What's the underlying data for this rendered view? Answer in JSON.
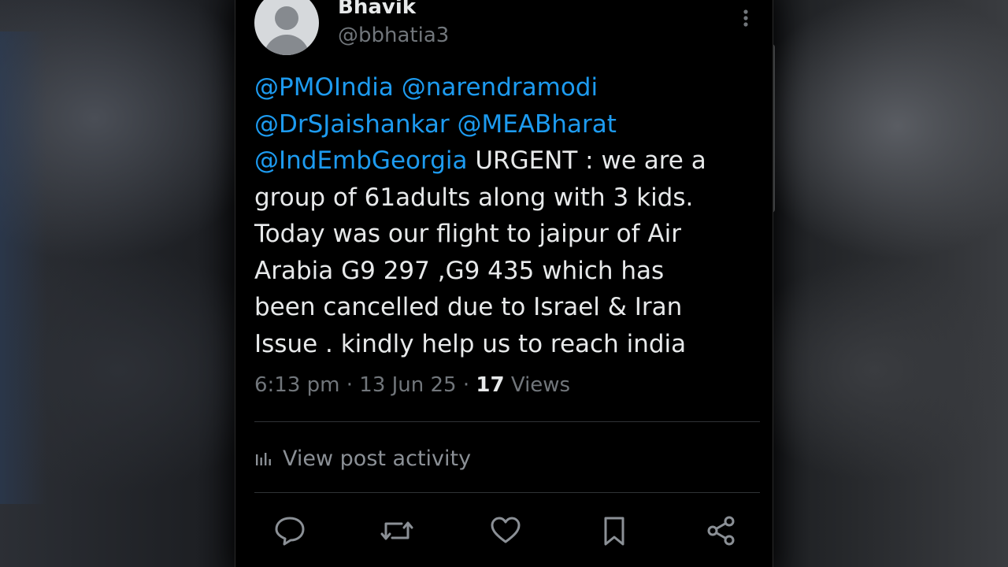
{
  "tweet": {
    "author_name": "Bhavik",
    "author_handle": "@bbhatia3",
    "mentions_line1": [
      "@PMOIndia",
      "@narendramodi"
    ],
    "mentions_line2": [
      "@DrSJaishankar",
      "@MEABharat"
    ],
    "mention_line3": "@IndEmbGeorgia",
    "body_start": "URGENT : we are a",
    "body_rest": "group of 61adults  along with  3 kids.\nToday was our flight to jaipur of Air\nArabia G9 297 ,G9 435  which has\nbeen cancelled due to Israel & Iran\nIssue .  kindly help us to  reach india",
    "time": "6:13 pm",
    "date": "13 Jun 25",
    "views_count": "17",
    "views_label": "Views"
  },
  "activity": {
    "label": "View post activity",
    "icon": "analytics-bars-icon"
  },
  "actions": [
    {
      "name": "reply",
      "icon": "speech-bubble-icon"
    },
    {
      "name": "repost",
      "icon": "repost-arrows-icon"
    },
    {
      "name": "like",
      "icon": "heart-icon"
    },
    {
      "name": "bookmark",
      "icon": "bookmark-icon"
    },
    {
      "name": "share",
      "icon": "share-nodes-icon"
    }
  ],
  "colors": {
    "background": "#000000",
    "text": "#e7e9ea",
    "muted": "#71767b",
    "link": "#1d9bf0",
    "divider": "#2f3336"
  }
}
